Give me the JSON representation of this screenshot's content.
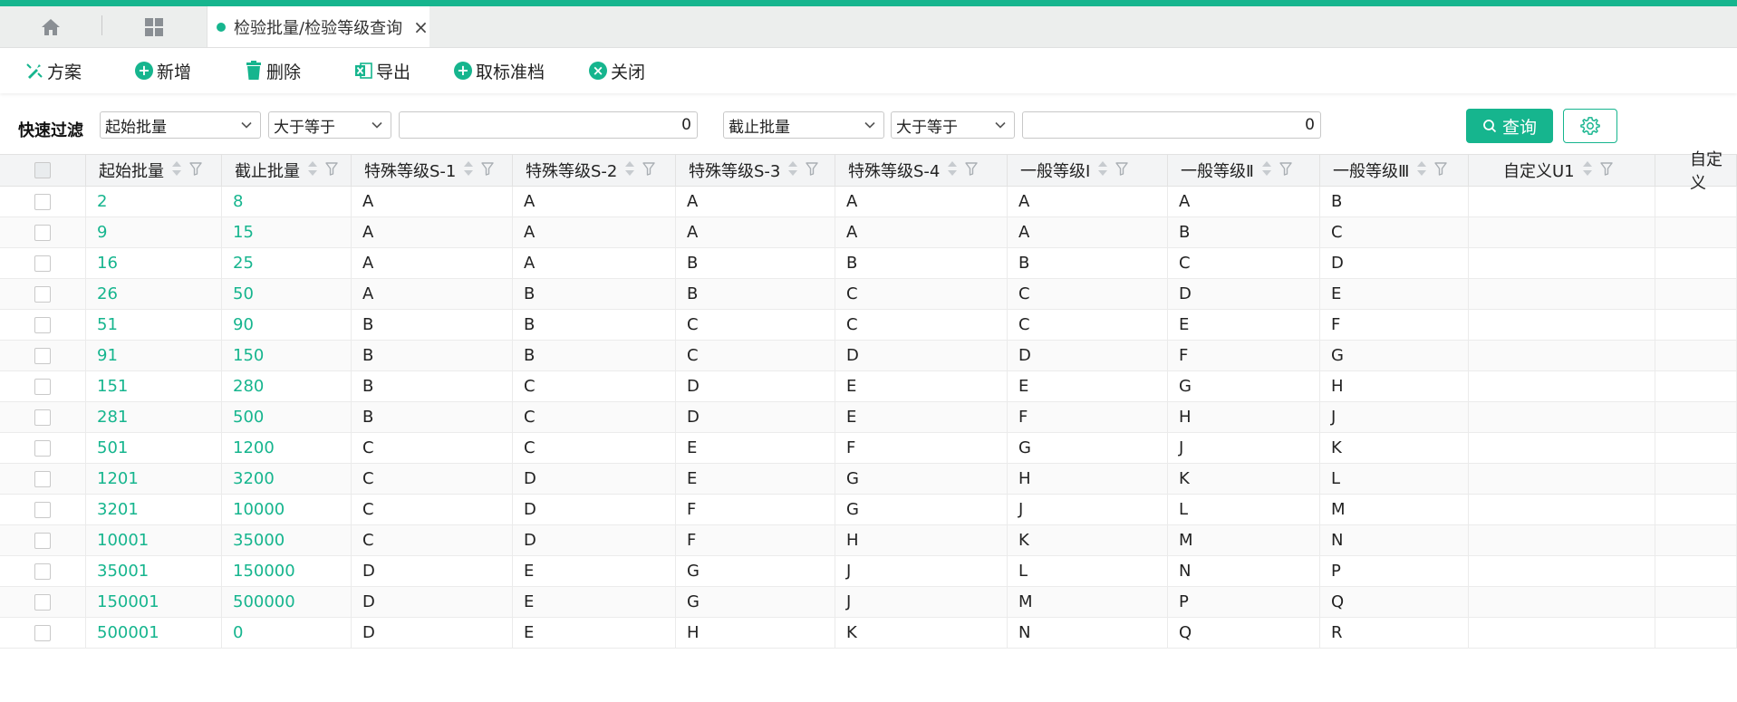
{
  "colors": {
    "accent": "#16b58e",
    "header_bg": "#f3f4f5"
  },
  "tabs": {
    "active_label": "检验批量/检验等级查询",
    "close_glyph": "×"
  },
  "toolbar": {
    "scheme": "方案",
    "add": "新增",
    "delete": "删除",
    "export": "导出",
    "cancel_archive": "取标准档",
    "close": "关闭"
  },
  "filter": {
    "label": "快速过滤",
    "field1": "起始批量",
    "op1": "大于等于",
    "value1": "0",
    "field2": "截止批量",
    "op2": "大于等于",
    "value2": "0",
    "query": "查询"
  },
  "grid": {
    "columns": [
      "起始批量",
      "截止批量",
      "特殊等级S-1",
      "特殊等级S-2",
      "特殊等级S-3",
      "特殊等级S-4",
      "一般等级Ⅰ",
      "一般等级Ⅱ",
      "一般等级Ⅲ",
      "自定义U1",
      "自定义"
    ],
    "rows": [
      [
        "2",
        "8",
        "A",
        "A",
        "A",
        "A",
        "A",
        "A",
        "B"
      ],
      [
        "9",
        "15",
        "A",
        "A",
        "A",
        "A",
        "A",
        "B",
        "C"
      ],
      [
        "16",
        "25",
        "A",
        "A",
        "B",
        "B",
        "B",
        "C",
        "D"
      ],
      [
        "26",
        "50",
        "A",
        "B",
        "B",
        "C",
        "C",
        "D",
        "E"
      ],
      [
        "51",
        "90",
        "B",
        "B",
        "C",
        "C",
        "C",
        "E",
        "F"
      ],
      [
        "91",
        "150",
        "B",
        "B",
        "C",
        "D",
        "D",
        "F",
        "G"
      ],
      [
        "151",
        "280",
        "B",
        "C",
        "D",
        "E",
        "E",
        "G",
        "H"
      ],
      [
        "281",
        "500",
        "B",
        "C",
        "D",
        "E",
        "F",
        "H",
        "J"
      ],
      [
        "501",
        "1200",
        "C",
        "C",
        "E",
        "F",
        "G",
        "J",
        "K"
      ],
      [
        "1201",
        "3200",
        "C",
        "D",
        "E",
        "G",
        "H",
        "K",
        "L"
      ],
      [
        "3201",
        "10000",
        "C",
        "D",
        "F",
        "G",
        "J",
        "L",
        "M"
      ],
      [
        "10001",
        "35000",
        "C",
        "D",
        "F",
        "H",
        "K",
        "M",
        "N"
      ],
      [
        "35001",
        "150000",
        "D",
        "E",
        "G",
        "J",
        "L",
        "N",
        "P"
      ],
      [
        "150001",
        "500000",
        "D",
        "E",
        "G",
        "J",
        "M",
        "P",
        "Q"
      ],
      [
        "500001",
        "0",
        "D",
        "E",
        "H",
        "K",
        "N",
        "Q",
        "R"
      ]
    ]
  }
}
